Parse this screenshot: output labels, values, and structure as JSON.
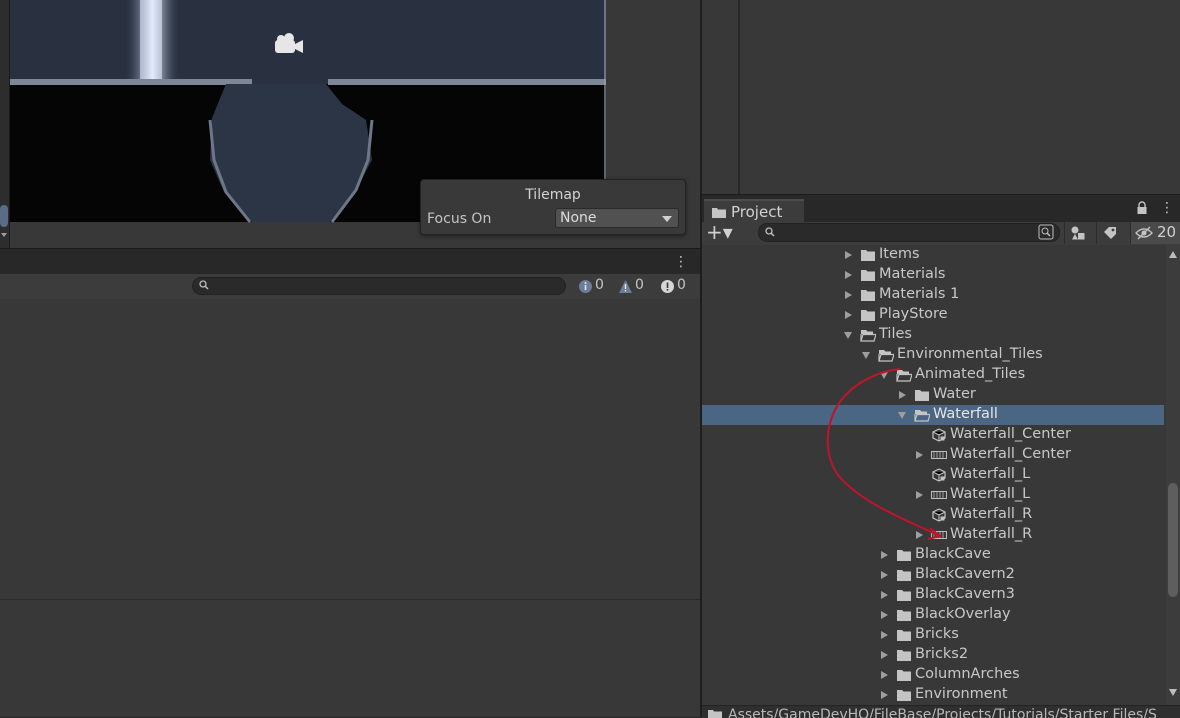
{
  "tilemap_overlay": {
    "title": "Tilemap",
    "focus_label": "Focus On",
    "focus_value": "None"
  },
  "console": {
    "info_count": "0",
    "warning_count": "0",
    "error_count": "0"
  },
  "project": {
    "tab_label": "Project",
    "add_label": "+▾",
    "hidden_count": "20",
    "tree": [
      {
        "label": "Items",
        "type": "folder",
        "depth": 0,
        "expanded": false,
        "has_arrow": true
      },
      {
        "label": "Materials",
        "type": "folder",
        "depth": 0,
        "expanded": false,
        "has_arrow": true
      },
      {
        "label": "Materials 1",
        "type": "folder",
        "depth": 0,
        "expanded": false,
        "has_arrow": true
      },
      {
        "label": "PlayStore",
        "type": "folder",
        "depth": 0,
        "expanded": false,
        "has_arrow": true
      },
      {
        "label": "Tiles",
        "type": "folder-open",
        "depth": 0,
        "expanded": true,
        "has_arrow": true
      },
      {
        "label": "Environmental_Tiles",
        "type": "folder-open",
        "depth": 1,
        "expanded": true,
        "has_arrow": true
      },
      {
        "label": "Animated_Tiles",
        "type": "folder-open",
        "depth": 2,
        "expanded": true,
        "has_arrow": true
      },
      {
        "label": "Water",
        "type": "folder",
        "depth": 3,
        "expanded": false,
        "has_arrow": true
      },
      {
        "label": "Waterfall",
        "type": "folder-open",
        "depth": 3,
        "expanded": true,
        "has_arrow": true,
        "selected": true
      },
      {
        "label": "Waterfall_Center",
        "type": "tile-asset",
        "depth": 4,
        "has_arrow": false
      },
      {
        "label": "Waterfall_Center",
        "type": "sprite-sheet",
        "depth": 4,
        "expanded": false,
        "has_arrow": true
      },
      {
        "label": "Waterfall_L",
        "type": "tile-asset",
        "depth": 4,
        "has_arrow": false
      },
      {
        "label": "Waterfall_L",
        "type": "sprite-sheet",
        "depth": 4,
        "expanded": false,
        "has_arrow": true
      },
      {
        "label": "Waterfall_R",
        "type": "tile-asset",
        "depth": 4,
        "has_arrow": false
      },
      {
        "label": "Waterfall_R",
        "type": "sprite-sheet",
        "depth": 4,
        "expanded": false,
        "has_arrow": true
      },
      {
        "label": "BlackCave",
        "type": "folder",
        "depth": 2,
        "expanded": false,
        "has_arrow": true
      },
      {
        "label": "BlackCavern2",
        "type": "folder",
        "depth": 2,
        "expanded": false,
        "has_arrow": true
      },
      {
        "label": "BlackCavern3",
        "type": "folder",
        "depth": 2,
        "expanded": false,
        "has_arrow": true
      },
      {
        "label": "BlackOverlay",
        "type": "folder",
        "depth": 2,
        "expanded": false,
        "has_arrow": true
      },
      {
        "label": "Bricks",
        "type": "folder",
        "depth": 2,
        "expanded": false,
        "has_arrow": true
      },
      {
        "label": "Bricks2",
        "type": "folder",
        "depth": 2,
        "expanded": false,
        "has_arrow": true
      },
      {
        "label": "ColumnArches",
        "type": "folder",
        "depth": 2,
        "expanded": false,
        "has_arrow": true
      },
      {
        "label": "Environment",
        "type": "folder",
        "depth": 2,
        "expanded": false,
        "has_arrow": true
      }
    ],
    "footer_path": "Assets/GameDevHQ/FileBase/Projects/Tutorials/Starter Files/S"
  },
  "colors": {
    "selection": "#4b6683",
    "annotation": "#c0142a",
    "panel": "#383838"
  },
  "icons": [
    "camera-gizmo-icon",
    "search-icon",
    "info-icon",
    "warning-icon",
    "error-icon",
    "folder-icon",
    "lock-icon",
    "kebab-menu-icon",
    "search-by-type-icon",
    "search-by-label-icon",
    "hidden-packages-icon"
  ]
}
